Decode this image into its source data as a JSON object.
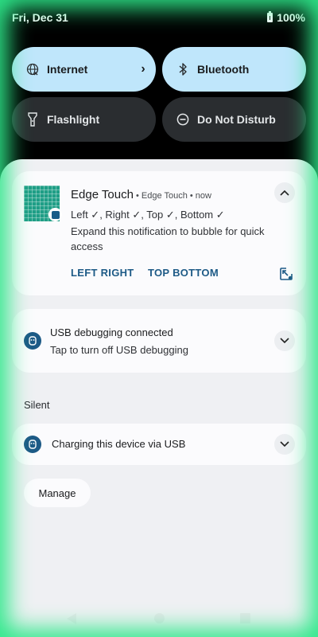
{
  "status_bar": {
    "date": "Fri, Dec 31",
    "battery": "100%"
  },
  "quick_settings": {
    "tiles": [
      {
        "label": "Internet",
        "state": "on",
        "icon": "wifi-x-icon",
        "has_chevron": true
      },
      {
        "label": "Bluetooth",
        "state": "on",
        "icon": "bluetooth-icon"
      },
      {
        "label": "Flashlight",
        "state": "off",
        "icon": "flashlight-icon"
      },
      {
        "label": "Do Not Disturb",
        "state": "off",
        "icon": "do-not-disturb-icon"
      }
    ],
    "chevron": "›"
  },
  "notifications": {
    "edge_touch": {
      "title": "Edge Touch",
      "meta": " • Edge Touch • now",
      "line1": "Left ✓, Right ✓, Top ✓, Bottom ✓",
      "line2": "Expand this notification to bubble for quick access",
      "actions": [
        "LEFT RIGHT",
        "TOP BOTTOM"
      ]
    },
    "usb_debugging": {
      "title": "USB debugging connected",
      "subtitle": "Tap to turn off USB debugging"
    },
    "section_silent": "Silent",
    "charging": {
      "title": "Charging this device via USB"
    }
  },
  "manage_label": "Manage",
  "colors": {
    "accent": "#1d5a86",
    "tile_on": "#bfe6fb",
    "tile_off": "#2a2d30",
    "edge_glow": "#2ee88a"
  }
}
